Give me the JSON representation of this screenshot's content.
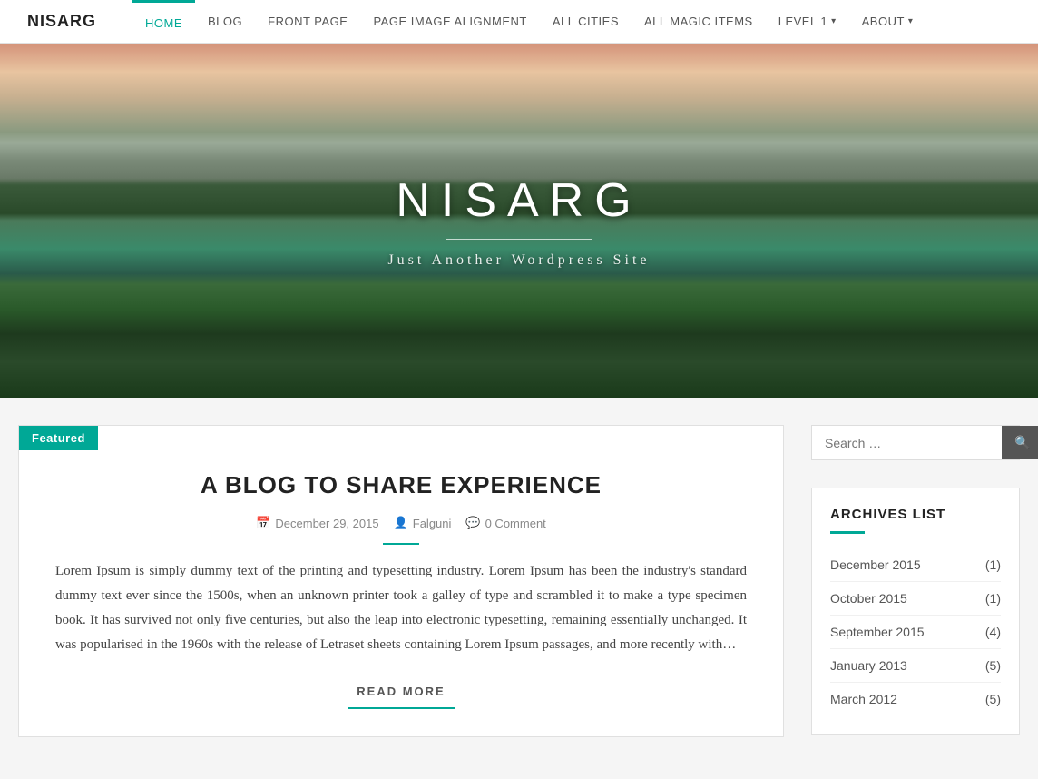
{
  "brand": "NISARG",
  "nav": {
    "links": [
      {
        "label": "HOME",
        "active": true
      },
      {
        "label": "BLOG",
        "active": false
      },
      {
        "label": "FRONT PAGE",
        "active": false
      },
      {
        "label": "PAGE IMAGE ALIGNMENT",
        "active": false
      },
      {
        "label": "ALL CITIES",
        "active": false
      },
      {
        "label": "ALL MAGIC ITEMS",
        "active": false
      },
      {
        "label": "LEVEL 1",
        "active": false,
        "dropdown": true
      },
      {
        "label": "ABOUT",
        "active": false,
        "dropdown": true
      }
    ]
  },
  "hero": {
    "title": "NISARG",
    "subtitle": "Just Another Wordpress Site"
  },
  "post": {
    "featured_label": "Featured",
    "title": "A BLOG TO SHARE EXPERIENCE",
    "date": "December 29, 2015",
    "author": "Falguni",
    "comment_count": "0 Comment",
    "body": "Lorem Ipsum is simply dummy text of the printing and typesetting industry. Lorem Ipsum has been the industry's standard dummy text ever since the 1500s, when an unknown printer took a galley of type and scrambled it to make a type specimen book. It has survived not only five centuries, but also the leap into electronic typesetting, remaining essentially unchanged. It was popularised in the 1960s with the release of Letraset sheets containing Lorem Ipsum passages, and more recently with…",
    "read_more": "READ MORE"
  },
  "sidebar": {
    "search_placeholder": "Search …",
    "archives_title": "ARCHIVES LIST",
    "archives": [
      {
        "label": "December 2015",
        "count": "(1)"
      },
      {
        "label": "October 2015",
        "count": "(1)"
      },
      {
        "label": "September 2015",
        "count": "(4)"
      },
      {
        "label": "January 2013",
        "count": "(5)"
      },
      {
        "label": "March 2012",
        "count": "(5)"
      }
    ]
  }
}
